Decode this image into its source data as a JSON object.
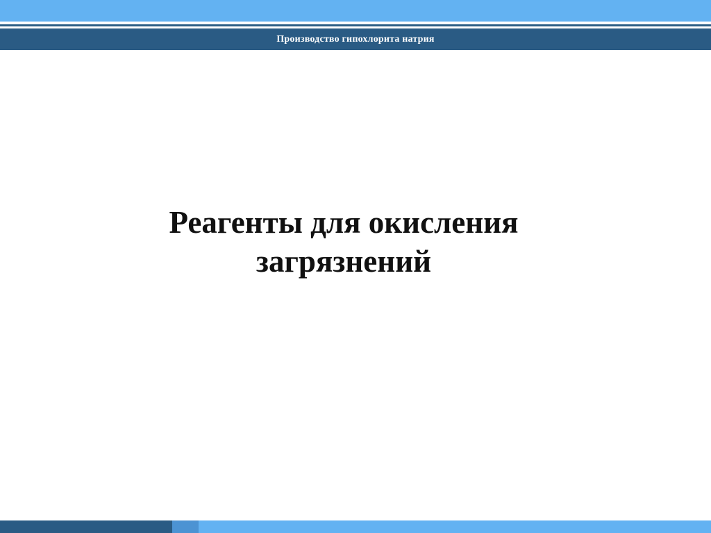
{
  "header": {
    "title": "Производство гипохлорита натрия"
  },
  "slide": {
    "title_line1": "Реагенты для окисления",
    "title_line2": "загрязнений"
  },
  "colors": {
    "light_blue": "#63b2f2",
    "dark_blue": "#2a5b84",
    "mid_blue": "#4c93d3",
    "background": "#ffffff",
    "text": "#111111"
  }
}
